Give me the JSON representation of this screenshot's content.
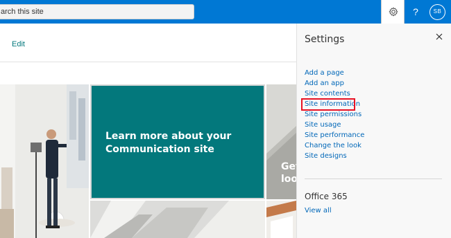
{
  "topbar": {
    "search_placeholder": "arch this site",
    "help_symbol": "?",
    "avatar_initials": "SB",
    "colors": {
      "bar": "#0078d4"
    }
  },
  "page": {
    "edit_label": "Edit",
    "hero_tile_title": "Learn more about your Communication site",
    "side_tile_text": "Get\nloo",
    "colors": {
      "teal_tile": "#03787c"
    }
  },
  "settings": {
    "title": "Settings",
    "links": [
      "Add a page",
      "Add an app",
      "Site contents",
      "Site information",
      "Site permissions",
      "Site usage",
      "Site performance",
      "Change the look",
      "Site designs"
    ],
    "highlighted_link": "Site information",
    "office_title": "Office 365",
    "view_all_label": "View all",
    "colors": {
      "link": "#0067b8",
      "highlight_border": "#e81123"
    }
  },
  "icons": [
    "gear-icon",
    "help-icon",
    "close-icon"
  ]
}
